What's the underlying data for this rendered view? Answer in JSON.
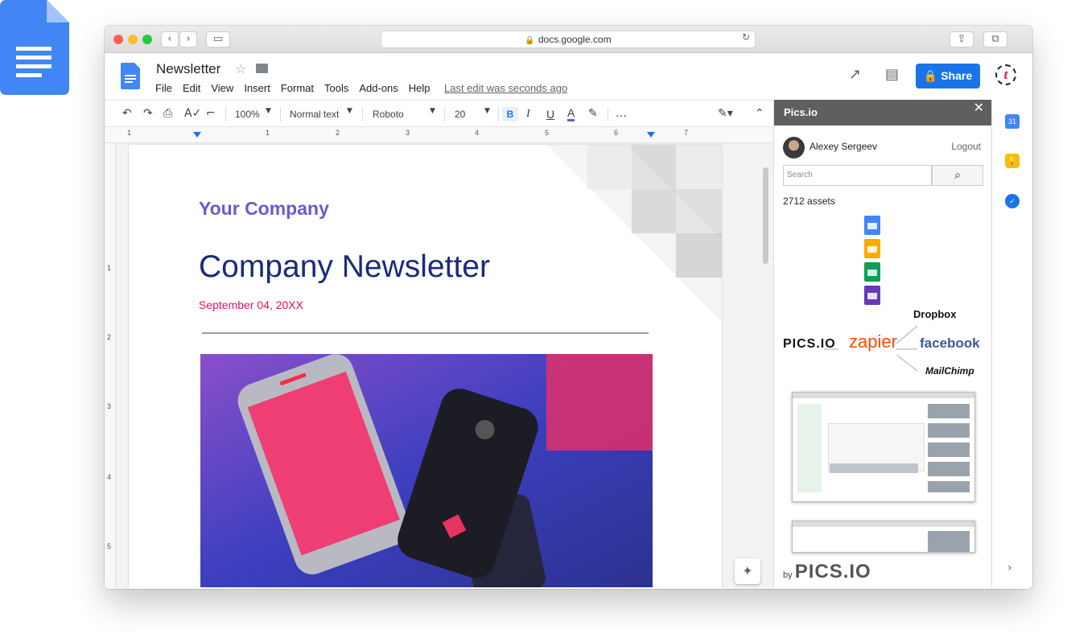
{
  "browser": {
    "url": "docs.google.com",
    "new_tab": "+"
  },
  "doc": {
    "title": "Newsletter",
    "menu": [
      "File",
      "Edit",
      "View",
      "Insert",
      "Format",
      "Tools",
      "Add-ons",
      "Help"
    ],
    "last_edit": "Last edit was seconds ago",
    "share_label": "Share",
    "addon_logo": "t"
  },
  "toolbar": {
    "zoom": "100%",
    "style": "Normal text",
    "font": "Roboto",
    "size": "20",
    "bold": "B",
    "italic": "I",
    "underline": "U",
    "text_color": "A",
    "more": "…"
  },
  "ruler": {
    "h": [
      "1",
      "1",
      "2",
      "3",
      "4",
      "5",
      "6",
      "7"
    ],
    "v": [
      "1",
      "2",
      "3",
      "4",
      "5"
    ]
  },
  "page": {
    "company": "Your Company",
    "heading": "Company Newsletter",
    "date": "September 04, 20XX"
  },
  "sidebar": {
    "title": "Pics.io",
    "user": "Alexey Sergeev",
    "logout": "Logout",
    "search_placeholder": "Search",
    "assets": "2712 assets",
    "integrations": {
      "picsio": "PICS.IO",
      "zapier": "zapier",
      "dropbox": "Dropbox",
      "facebook": "facebook",
      "mailchimp": "MailChimp"
    },
    "by": "by",
    "footer_brand": "PICS.IO"
  },
  "colors": {
    "accent": "#1a73e8",
    "company": "#6a5acd",
    "heading": "#1a2b7c",
    "date": "#e0115f"
  }
}
